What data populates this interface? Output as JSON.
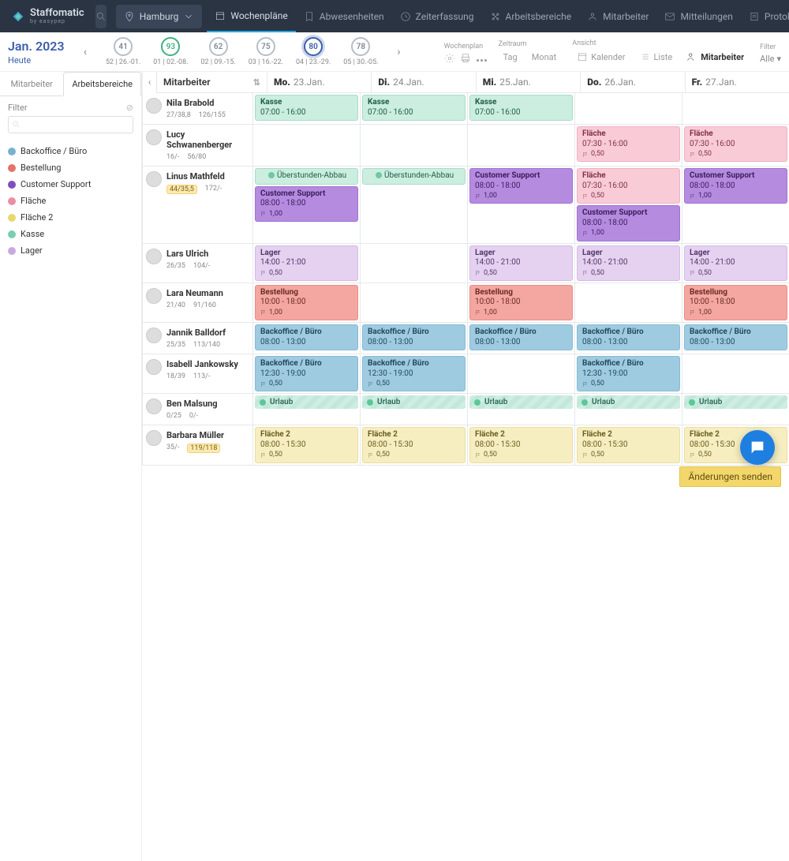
{
  "brand": {
    "name": "Staffomatic",
    "sub": "by easypep"
  },
  "nav": {
    "location": "Hamburg",
    "items": [
      "Wochenpläne",
      "Abwesenheiten",
      "Zeiterfassung",
      "Arbeitsbereiche",
      "Mitarbeiter",
      "Mitteilungen",
      "Protokoll"
    ],
    "active": 0
  },
  "toolbar": {
    "month": "Jan. 2023",
    "today": "Heute",
    "weeks": [
      {
        "num": "41",
        "label": "52 | 26.-01."
      },
      {
        "num": "93",
        "label": "01 | 02.-08."
      },
      {
        "num": "62",
        "label": "02 | 09.-15."
      },
      {
        "num": "75",
        "label": "03 | 16.-22."
      },
      {
        "num": "80",
        "label": "04 | 23.-29."
      },
      {
        "num": "78",
        "label": "05 | 30.-05."
      }
    ],
    "activeWeek": 4,
    "r": {
      "wochenplan": "Wochenplan",
      "zeitraum": "Zeitraum",
      "zeitraumOpts": [
        "Tag",
        "Monat"
      ],
      "ansicht": "Ansicht",
      "ansichtOpts": [
        "Kalender",
        "Liste",
        "Mitarbeiter"
      ],
      "ansichtActive": "Mitarbeiter",
      "filter": "Filter",
      "filterSel": "Alle"
    }
  },
  "sidebar": {
    "tabs": [
      "Mitarbeiter",
      "Arbeitsbereiche"
    ],
    "activeTab": 1,
    "filterLabel": "Filter",
    "depts": [
      {
        "name": "Backoffice / Büro",
        "color": "#77b3d1"
      },
      {
        "name": "Bestellung",
        "color": "#e57368"
      },
      {
        "name": "Customer Support",
        "color": "#7d4ec0"
      },
      {
        "name": "Fläche",
        "color": "#e98fa5"
      },
      {
        "name": "Fläche 2",
        "color": "#e8d96e"
      },
      {
        "name": "Kasse",
        "color": "#7bcfae"
      },
      {
        "name": "Lager",
        "color": "#c9a9e0"
      }
    ]
  },
  "grid": {
    "colHeaderLabel": "Mitarbeiter",
    "days": [
      {
        "dow": "Mo.",
        "date": "23.Jan."
      },
      {
        "dow": "Di.",
        "date": "24.Jan."
      },
      {
        "dow": "Mi.",
        "date": "25.Jan."
      },
      {
        "dow": "Do.",
        "date": "26.Jan."
      },
      {
        "dow": "Fr.",
        "date": "27.Jan."
      }
    ],
    "employees": [
      {
        "name": "Nila Brabold",
        "stats": [
          "27/38,8",
          "126/155"
        ],
        "cells": [
          [
            {
              "dept": "Kasse",
              "time": "07:00 - 16:00",
              "cls": "c-kasse"
            }
          ],
          [
            {
              "dept": "Kasse",
              "time": "07:00 - 16:00",
              "cls": "c-kasse"
            }
          ],
          [
            {
              "dept": "Kasse",
              "time": "07:00 - 16:00",
              "cls": "c-kasse"
            }
          ],
          [],
          []
        ]
      },
      {
        "name": "Lucy Schwanenberger",
        "stats": [
          "16/-",
          "56/80"
        ],
        "cells": [
          [],
          [],
          [],
          [
            {
              "dept": "Fläche",
              "time": "07:30 - 16:00",
              "meta": "0,50",
              "cls": "c-flaeche"
            }
          ],
          [
            {
              "dept": "Fläche",
              "time": "07:30 - 16:00",
              "meta": "0,50",
              "cls": "c-flaeche"
            }
          ]
        ]
      },
      {
        "name": "Linus Mathfeld",
        "statsChip": "44/35,5",
        "stats": [
          "172/-"
        ],
        "cells": [
          [
            {
              "label": "Überstunden-Abbau",
              "cls": "c-kasse",
              "badge": true
            },
            {
              "dept": "Customer Support",
              "time": "08:00 - 18:00",
              "meta": "1,00",
              "cls": "c-cs"
            }
          ],
          [
            {
              "label": "Überstunden-Abbau",
              "cls": "c-kasse",
              "badge": true
            }
          ],
          [
            {
              "dept": "Customer Support",
              "time": "08:00 - 18:00",
              "meta": "1,00",
              "cls": "c-cs"
            }
          ],
          [
            {
              "dept": "Fläche",
              "time": "07:30 - 16:00",
              "meta": "0,50",
              "cls": "c-flaeche"
            },
            {
              "dept": "Customer Support",
              "time": "08:00 - 18:00",
              "meta": "1,00",
              "cls": "c-cs"
            }
          ],
          [
            {
              "dept": "Customer Support",
              "time": "08:00 - 18:00",
              "meta": "1,00",
              "cls": "c-cs"
            }
          ]
        ]
      },
      {
        "name": "Lars Ulrich",
        "stats": [
          "26/35",
          "104/-"
        ],
        "cells": [
          [
            {
              "dept": "Lager",
              "time": "14:00 - 21:00",
              "meta": "0,50",
              "cls": "c-lager"
            }
          ],
          [],
          [
            {
              "dept": "Lager",
              "time": "14:00 - 21:00",
              "meta": "0,50",
              "cls": "c-lager"
            }
          ],
          [
            {
              "dept": "Lager",
              "time": "14:00 - 21:00",
              "meta": "0,50",
              "cls": "c-lager"
            }
          ],
          [
            {
              "dept": "Lager",
              "time": "14:00 - 21:00",
              "meta": "0,50",
              "cls": "c-lager"
            }
          ]
        ]
      },
      {
        "name": "Lara Neumann",
        "stats": [
          "21/40",
          "91/160"
        ],
        "cells": [
          [
            {
              "dept": "Bestellung",
              "time": "10:00 - 18:00",
              "meta": "1,00",
              "cls": "c-best"
            }
          ],
          [],
          [
            {
              "dept": "Bestellung",
              "time": "10:00 - 18:00",
              "meta": "1,00",
              "cls": "c-best"
            }
          ],
          [],
          [
            {
              "dept": "Bestellung",
              "time": "10:00 - 18:00",
              "meta": "1,00",
              "cls": "c-best"
            }
          ]
        ]
      },
      {
        "name": "Jannik Balldorf",
        "stats": [
          "25/35",
          "113/140"
        ],
        "cells": [
          [
            {
              "dept": "Backoffice / Büro",
              "time": "08:00 - 13:00",
              "cls": "c-back"
            }
          ],
          [
            {
              "dept": "Backoffice / Büro",
              "time": "08:00 - 13:00",
              "cls": "c-back"
            }
          ],
          [
            {
              "dept": "Backoffice / Büro",
              "time": "08:00 - 13:00",
              "cls": "c-back"
            }
          ],
          [
            {
              "dept": "Backoffice / Büro",
              "time": "08:00 - 13:00",
              "cls": "c-back"
            }
          ],
          [
            {
              "dept": "Backoffice / Büro",
              "time": "08:00 - 13:00",
              "cls": "c-back"
            }
          ]
        ]
      },
      {
        "name": "Isabell Jankowsky",
        "stats": [
          "18/39",
          "113/-"
        ],
        "cells": [
          [
            {
              "dept": "Backoffice / Büro",
              "time": "12:30 - 19:00",
              "meta": "0,50",
              "cls": "c-back"
            }
          ],
          [
            {
              "dept": "Backoffice / Büro",
              "time": "12:30 - 19:00",
              "meta": "0,50",
              "cls": "c-back"
            }
          ],
          [],
          [
            {
              "dept": "Backoffice / Büro",
              "time": "12:30 - 19:00",
              "meta": "0,50",
              "cls": "c-back"
            }
          ],
          []
        ]
      },
      {
        "name": "Ben Malsung",
        "stats": [
          "0/25",
          "0/-"
        ],
        "cells": [
          [
            {
              "vac": "Urlaub"
            }
          ],
          [
            {
              "vac": "Urlaub"
            }
          ],
          [
            {
              "vac": "Urlaub"
            }
          ],
          [
            {
              "vac": "Urlaub"
            }
          ],
          [
            {
              "vac": "Urlaub"
            }
          ]
        ]
      },
      {
        "name": "Barbara Müller",
        "stats": [
          "35/-"
        ],
        "statsChip2": "119/118",
        "cells": [
          [
            {
              "dept": "Fläche 2",
              "time": "08:00 - 15:30",
              "meta": "0,50",
              "cls": "c-f2"
            }
          ],
          [
            {
              "dept": "Fläche 2",
              "time": "08:00 - 15:30",
              "meta": "0,50",
              "cls": "c-f2"
            }
          ],
          [
            {
              "dept": "Fläche 2",
              "time": "08:00 - 15:30",
              "meta": "0,50",
              "cls": "c-f2"
            }
          ],
          [
            {
              "dept": "Fläche 2",
              "time": "08:00 - 15:30",
              "meta": "0,50",
              "cls": "c-f2"
            }
          ],
          [
            {
              "dept": "Fläche 2",
              "time": "08:00 - 15:30",
              "meta": "0,50",
              "cls": "c-f2"
            }
          ]
        ]
      }
    ]
  },
  "changesButton": "Änderungen senden"
}
